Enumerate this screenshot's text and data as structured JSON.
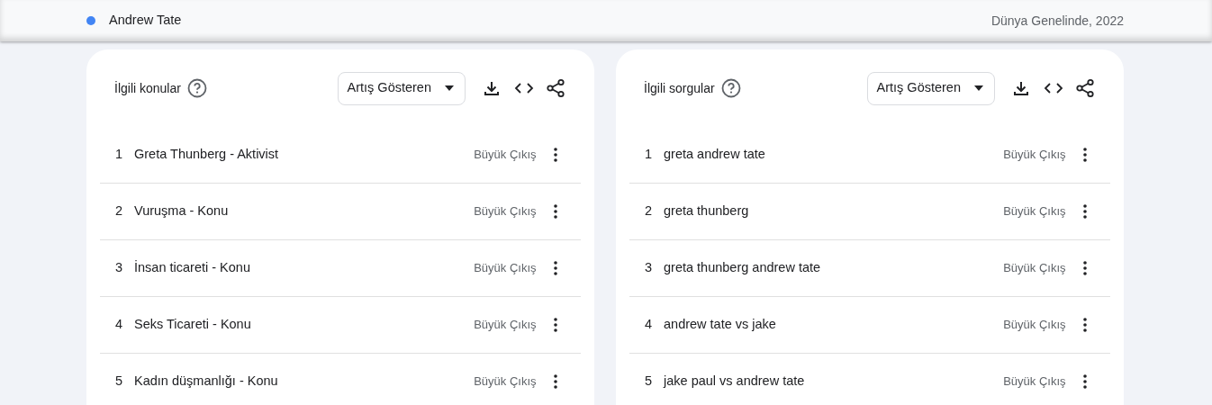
{
  "header": {
    "series": {
      "name": "Andrew Tate",
      "color": "#4285f4"
    },
    "region_period": "Dünya Genelinde, 2022"
  },
  "panels": [
    {
      "title": "İlgili konular",
      "dropdown": "Artış Gösteren",
      "rows": [
        {
          "rank": "1",
          "label": "Greta Thunberg - Aktivist",
          "value": "Büyük Çıkış"
        },
        {
          "rank": "2",
          "label": "Vuruşma - Konu",
          "value": "Büyük Çıkış"
        },
        {
          "rank": "3",
          "label": "İnsan ticareti - Konu",
          "value": "Büyük Çıkış"
        },
        {
          "rank": "4",
          "label": "Seks Ticareti - Konu",
          "value": "Büyük Çıkış"
        },
        {
          "rank": "5",
          "label": "Kadın düşmanlığı - Konu",
          "value": "Büyük Çıkış"
        }
      ]
    },
    {
      "title": "İlgili sorgular",
      "dropdown": "Artış Gösteren",
      "rows": [
        {
          "rank": "1",
          "label": "greta andrew tate",
          "value": "Büyük Çıkış"
        },
        {
          "rank": "2",
          "label": "greta thunberg",
          "value": "Büyük Çıkış"
        },
        {
          "rank": "3",
          "label": "greta thunberg andrew tate",
          "value": "Büyük Çıkış"
        },
        {
          "rank": "4",
          "label": "andrew tate vs jake",
          "value": "Büyük Çıkış"
        },
        {
          "rank": "5",
          "label": "jake paul vs andrew tate",
          "value": "Büyük Çıkış"
        }
      ]
    }
  ]
}
